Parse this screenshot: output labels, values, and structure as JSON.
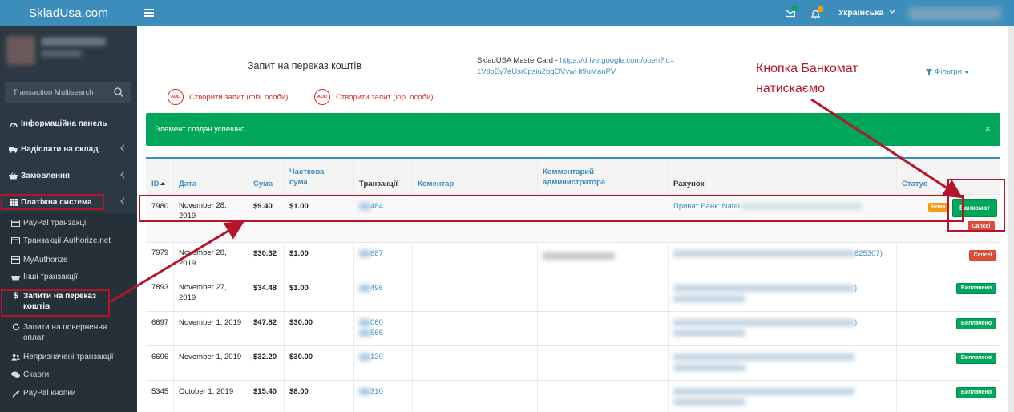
{
  "brand": "SkladUsa.com",
  "sidebar": {
    "search_placeholder": "Transaction Multisearch",
    "nav": [
      {
        "label": "Інформаційна панель",
        "icon": "dashboard-icon"
      },
      {
        "label": "Надіслати на склад",
        "icon": "truck-icon"
      },
      {
        "label": "Замовлення",
        "icon": "basket-icon"
      },
      {
        "label": "Платіжна система",
        "icon": "grid-icon"
      }
    ],
    "sub": [
      {
        "label": "PayPal транзакції",
        "icon": "credit-card-icon"
      },
      {
        "label": "Транзакції Authorize.net",
        "icon": "credit-card-icon"
      },
      {
        "label": "MyAuthorize",
        "icon": "credit-card-icon"
      },
      {
        "label": "Інші транзакції",
        "icon": "basket-icon"
      },
      {
        "label": "Запити на переказ коштів",
        "icon": "dollar-icon"
      },
      {
        "label": "Запити на повернення оплат",
        "icon": "refresh-icon"
      },
      {
        "label": "Непризначені транзакції",
        "icon": "users-icon"
      },
      {
        "label": "Скарги",
        "icon": "comments-icon"
      },
      {
        "label": "PayPal кнопки",
        "icon": "magic-icon"
      }
    ]
  },
  "header": {
    "language": "Українська"
  },
  "page": {
    "title": "Запит на переказ коштів",
    "card_label": "SkladUSA MasterCard - ",
    "card_link": "https://drive.google.com/open?id=1VtloEy7eUsr0psiu2bqOVvwHt9uManPV",
    "create_individual": "Створити запит (фіз. особи)",
    "create_company": "Створити запит (юр. особи)",
    "add_badge": "ADD",
    "filters": "Фільтри",
    "alert": "Элемент создан успешно",
    "alert_close": "×"
  },
  "table": {
    "headers": {
      "id": "ID",
      "date": "Дата",
      "sum": "Сума",
      "partial_sum": "Часткова сума",
      "transactions": "Транзакції",
      "comment": "Коментар",
      "admin_comment": "Комментарий администратора",
      "account": "Рахунок",
      "status": "Статус"
    },
    "rows": [
      {
        "id": "7980",
        "date": "November 28, 2019",
        "sum": "$9.40",
        "partial": "$1.00",
        "tx": [
          "484"
        ],
        "account": "Приват Банк: Natal",
        "status": "Нова",
        "actions": [
          "Банкомат",
          "Cancel"
        ]
      },
      {
        "id": "7979",
        "date": "November 28, 2019",
        "sum": "$30.32",
        "partial": "$1.00",
        "tx": [
          "887"
        ],
        "account": "825307)",
        "status": "",
        "actions": [
          "Cancel"
        ]
      },
      {
        "id": "7893",
        "date": "November 27, 2019",
        "sum": "$34.48",
        "partial": "$1.00",
        "tx": [
          "496"
        ],
        "account": ")",
        "status": "Виплачено",
        "actions": []
      },
      {
        "id": "6697",
        "date": "November 1, 2019",
        "sum": "$47.82",
        "partial": "$30.00",
        "tx": [
          "060",
          "566"
        ],
        "account": ")",
        "status": "Виплачено",
        "actions": []
      },
      {
        "id": "6696",
        "date": "November 1, 2019",
        "sum": "$32.20",
        "partial": "$30.00",
        "tx": [
          "130"
        ],
        "account": "",
        "status": "Виплачено",
        "actions": []
      },
      {
        "id": "5345",
        "date": "October 1, 2019",
        "sum": "$15.40",
        "partial": "$8.00",
        "tx": [
          "310"
        ],
        "account": "",
        "status": "Виплачено",
        "actions": []
      }
    ]
  },
  "annotation": {
    "text": "Кнопка Банкомат натискаємо"
  },
  "colors": {
    "header": "#3c8dbc",
    "sidebar": "#2c3843",
    "success": "#00a65a",
    "danger": "#dd4b39",
    "warning": "#f39c12",
    "annotation": "#b3152a"
  }
}
